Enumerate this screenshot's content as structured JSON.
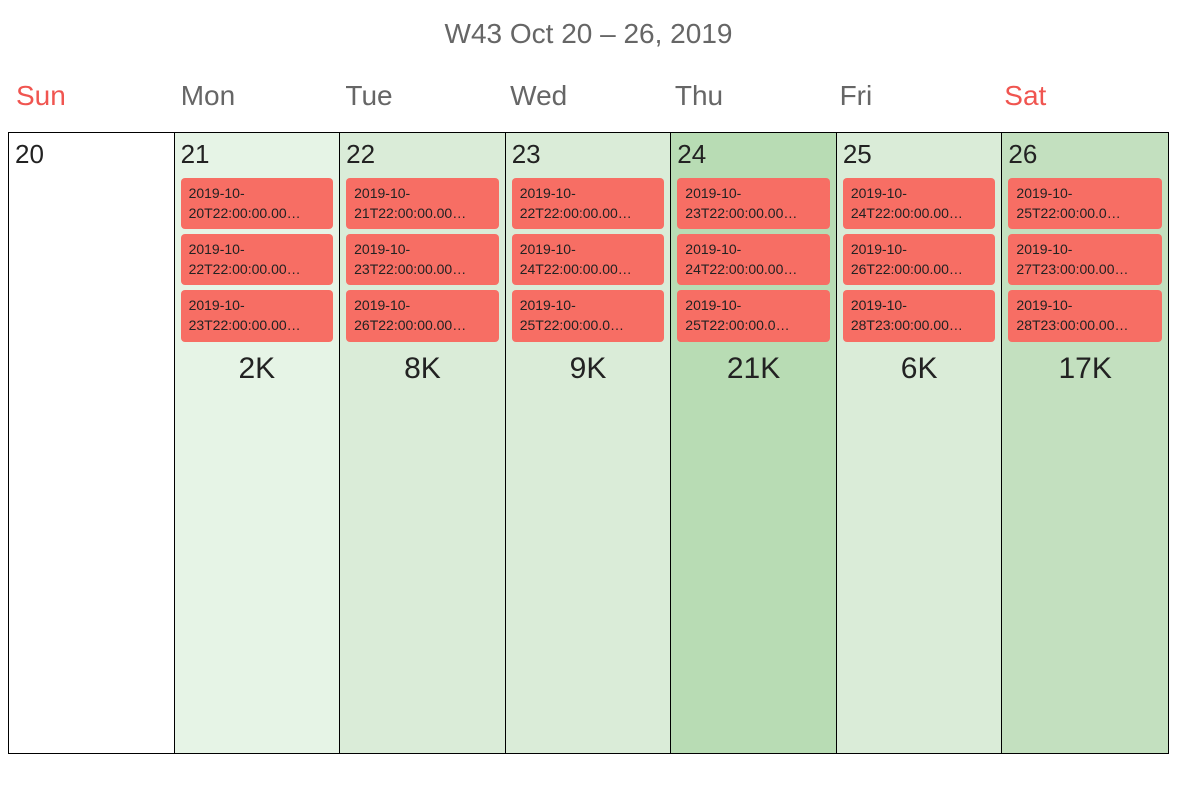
{
  "title": "W43 Oct 20 – 26, 2019",
  "dayHeaders": [
    {
      "label": "Sun",
      "weekend": true
    },
    {
      "label": "Mon",
      "weekend": false
    },
    {
      "label": "Tue",
      "weekend": false
    },
    {
      "label": "Wed",
      "weekend": false
    },
    {
      "label": "Thu",
      "weekend": false
    },
    {
      "label": "Fri",
      "weekend": false
    },
    {
      "label": "Sat",
      "weekend": true
    }
  ],
  "days": [
    {
      "number": "20",
      "shade": 0,
      "events": [],
      "total": ""
    },
    {
      "number": "21",
      "shade": 1,
      "events": [
        {
          "line1": "2019-10-",
          "line2": "20T22:00:00.00…"
        },
        {
          "line1": "2019-10-",
          "line2": "22T22:00:00.00…"
        },
        {
          "line1": "2019-10-",
          "line2": "23T22:00:00.00…"
        }
      ],
      "total": "2K"
    },
    {
      "number": "22",
      "shade": 2,
      "events": [
        {
          "line1": "2019-10-",
          "line2": "21T22:00:00.00…"
        },
        {
          "line1": "2019-10-",
          "line2": "23T22:00:00.00…"
        },
        {
          "line1": "2019-10-",
          "line2": "26T22:00:00.00…"
        }
      ],
      "total": "8K"
    },
    {
      "number": "23",
      "shade": 2,
      "events": [
        {
          "line1": "2019-10-",
          "line2": "22T22:00:00.00…"
        },
        {
          "line1": "2019-10-",
          "line2": "24T22:00:00.00…"
        },
        {
          "line1": "2019-10-",
          "line2": "25T22:00:00.0…"
        }
      ],
      "total": "9K"
    },
    {
      "number": "24",
      "shade": 5,
      "events": [
        {
          "line1": "2019-10-",
          "line2": "23T22:00:00.00…"
        },
        {
          "line1": "2019-10-",
          "line2": "24T22:00:00.00…"
        },
        {
          "line1": "2019-10-",
          "line2": "25T22:00:00.0…"
        }
      ],
      "total": "21K"
    },
    {
      "number": "25",
      "shade": 2,
      "events": [
        {
          "line1": "2019-10-",
          "line2": "24T22:00:00.00…"
        },
        {
          "line1": "2019-10-",
          "line2": "26T22:00:00.00…"
        },
        {
          "line1": "2019-10-",
          "line2": "28T23:00:00.00…"
        }
      ],
      "total": "6K"
    },
    {
      "number": "26",
      "shade": 4,
      "events": [
        {
          "line1": "2019-10-",
          "line2": "25T22:00:00.0…"
        },
        {
          "line1": "2019-10-",
          "line2": "27T23:00:00.00…"
        },
        {
          "line1": "2019-10-",
          "line2": "28T23:00:00.00…"
        }
      ],
      "total": "17K"
    }
  ]
}
